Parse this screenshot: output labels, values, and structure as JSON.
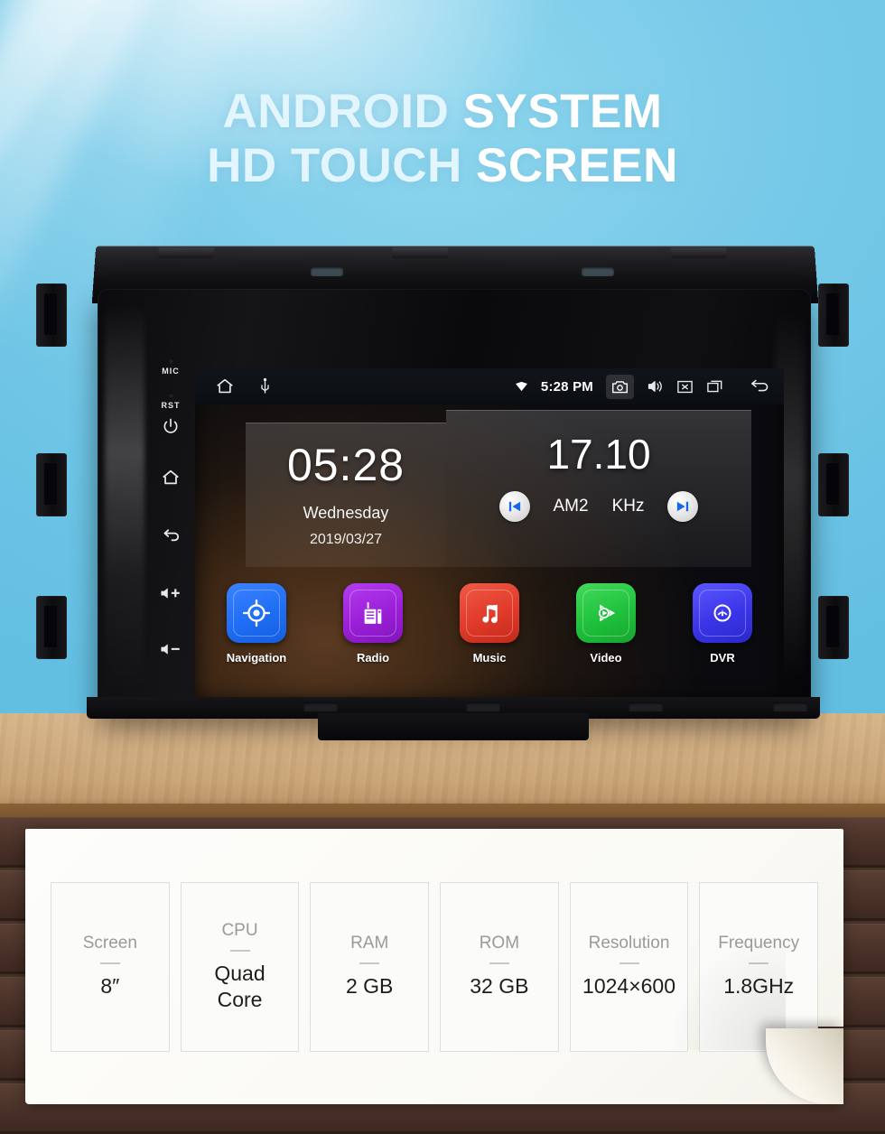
{
  "hero": {
    "headline_line1_a": "ANDROID ",
    "headline_line1_b": "SYSTEM",
    "headline_line2_a": "HD TOUCH ",
    "headline_line2_b": "SCREEN"
  },
  "device": {
    "left_keys": [
      {
        "name": "mic",
        "label": "MIC",
        "type": "text"
      },
      {
        "name": "reset",
        "label": "RST",
        "type": "text"
      },
      {
        "name": "power",
        "label": "power-icon",
        "type": "icon"
      },
      {
        "name": "home",
        "label": "home-icon",
        "type": "icon"
      },
      {
        "name": "back",
        "label": "back-icon",
        "type": "icon"
      },
      {
        "name": "volume-up",
        "label": "volume-up-icon",
        "type": "icon"
      },
      {
        "name": "volume-down",
        "label": "volume-down-icon",
        "type": "icon"
      }
    ]
  },
  "screen": {
    "status_bar": {
      "home_icon": "home-icon",
      "usb_icon": "usb-icon",
      "wifi_icon": "wifi-icon",
      "time": "5:28 PM",
      "camera_icon": "camera-icon",
      "volume_icon": "volume-icon",
      "close_icon": "close-box-icon",
      "recents_icon": "recent-apps-icon",
      "back_icon": "back-icon"
    },
    "clock_widget": {
      "time": "05:28",
      "weekday": "Wednesday",
      "date": "2019/03/27"
    },
    "radio_widget": {
      "frequency": "17.10",
      "band": "AM2",
      "unit": "KHz",
      "prev_icon": "skip-previous-icon",
      "next_icon": "skip-next-icon"
    },
    "apps": [
      {
        "label": "Navigation",
        "icon": "navigation-target-icon",
        "color": "#1f6ef5"
      },
      {
        "label": "Radio",
        "icon": "radio-icon",
        "color": "#9b1fd8"
      },
      {
        "label": "Music",
        "icon": "music-note-icon",
        "color": "#e03a2a"
      },
      {
        "label": "Video",
        "icon": "video-play-icon",
        "color": "#1fc13c"
      },
      {
        "label": "DVR",
        "icon": "dvr-gauge-icon",
        "color": "#3a36e8"
      }
    ]
  },
  "specs": [
    {
      "label": "Screen",
      "value": "8″"
    },
    {
      "label": "CPU",
      "value": "Quad\nCore"
    },
    {
      "label": "RAM",
      "value": "2 GB"
    },
    {
      "label": "ROM",
      "value": "32 GB"
    },
    {
      "label": "Resolution",
      "value": "1024×600"
    },
    {
      "label": "Frequency",
      "value": "1.8GHz"
    }
  ],
  "colors": {
    "sky": "#76c9e8",
    "headline": "#eefaff",
    "table": "#cfab7e",
    "wood": "#4a342a",
    "paper": "#fbfbf9"
  }
}
